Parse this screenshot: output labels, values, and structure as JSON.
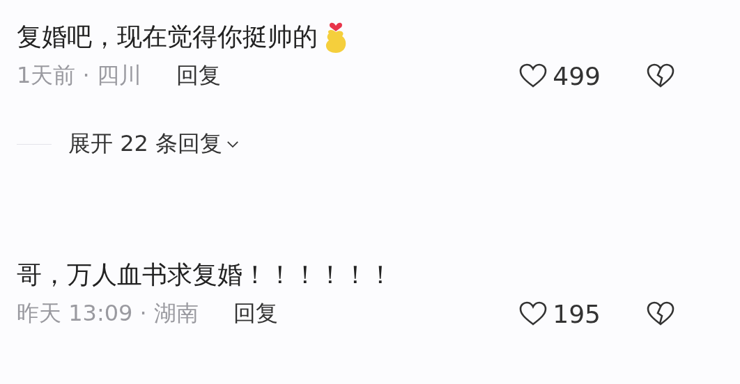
{
  "comments": [
    {
      "text": "复婚吧，现在觉得你挺帅的",
      "emoji": true,
      "meta": "1天前 · 四川",
      "reply": "回复",
      "likes": "499",
      "expand": "展开 22 条回复"
    },
    {
      "text": "哥，万人血书求复婚！！！！！！",
      "emoji": false,
      "meta": "昨天 13:09 · 湖南",
      "reply": "回复",
      "likes": "195"
    }
  ]
}
